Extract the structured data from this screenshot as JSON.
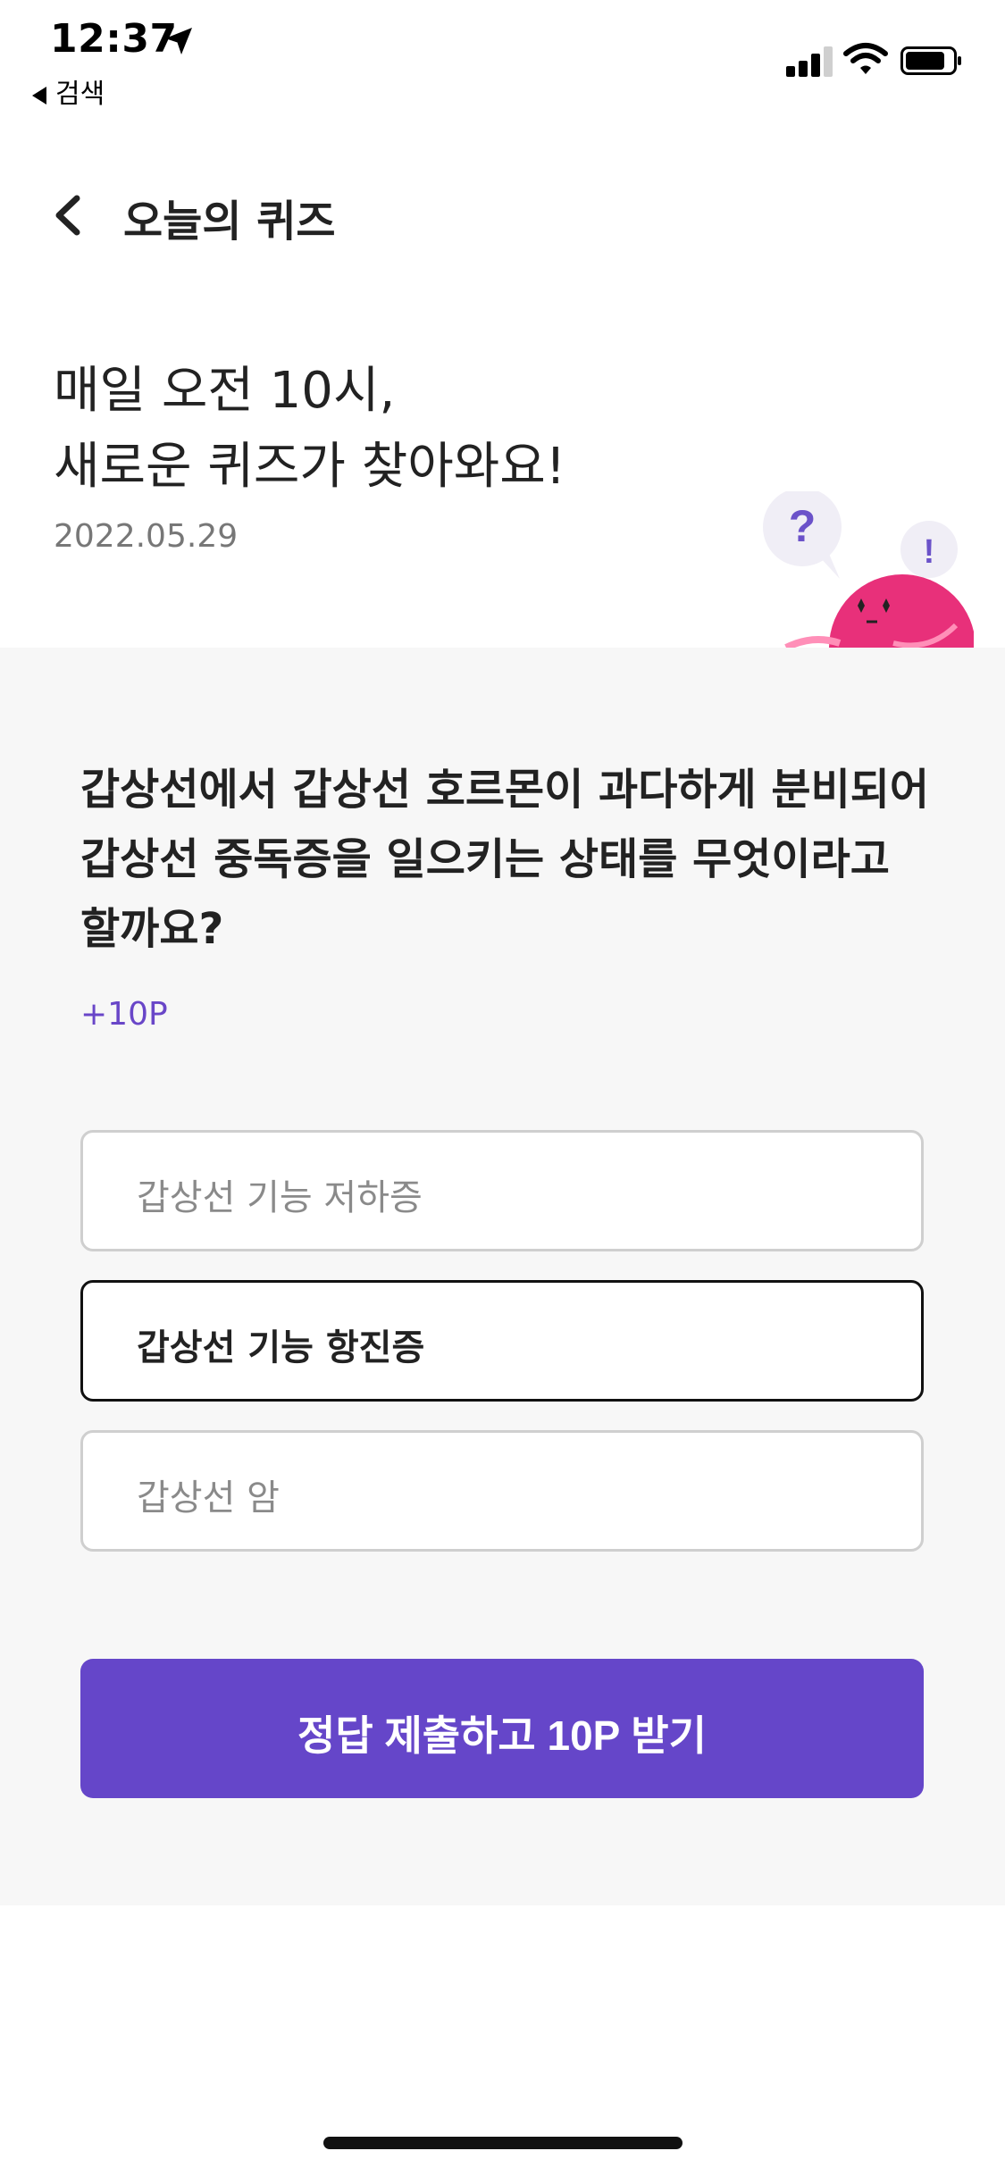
{
  "status_bar": {
    "time": "12:37",
    "back_app_label": "검색",
    "icons": [
      "location-arrow-icon",
      "signal-icon",
      "wifi-icon",
      "battery-icon"
    ]
  },
  "nav": {
    "title": "오늘의 퀴즈",
    "back_icon": "chevron-left-icon"
  },
  "hero": {
    "line1": "매일 오전 10시,",
    "line2": "새로운 퀴즈가 찾아와요!",
    "date": "2022.05.29",
    "mascot_bubble_question": "?",
    "mascot_bubble_exclaim": "!"
  },
  "quiz": {
    "question": "갑상선에서 갑상선 호르몬이 과다하게 분비되어 갑상선 중독증을 일으키는 상태를 무엇이라고 할까요?",
    "points": "+10P",
    "options": [
      {
        "label": "갑상선 기능 저하증",
        "selected": false
      },
      {
        "label": "갑상선 기능 항진증",
        "selected": true
      },
      {
        "label": "갑상선 암",
        "selected": false
      }
    ],
    "submit_label": "정답 제출하고 10P 받기"
  },
  "colors": {
    "accent": "#6546c9",
    "points_text": "#6946c8",
    "mascot": "#e8307a",
    "section_bg": "#f7f7f7"
  }
}
